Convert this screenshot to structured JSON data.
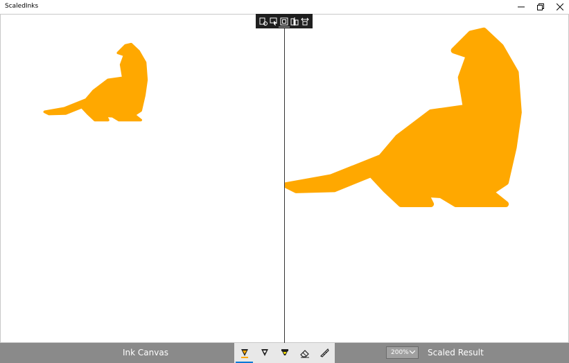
{
  "window": {
    "title": "ScaledInks"
  },
  "canvas": {
    "ink_color": "#FFA800"
  },
  "labels": {
    "left": "Ink Canvas",
    "right": "Scaled Result"
  },
  "zoom": {
    "selected": "200%"
  },
  "ink_toolbar": {
    "tools": [
      {
        "name": "ballpoint-pen",
        "selected": true
      },
      {
        "name": "pencil",
        "selected": false
      },
      {
        "name": "highlighter",
        "selected": false
      },
      {
        "name": "eraser",
        "selected": false
      },
      {
        "name": "ruler",
        "selected": false
      }
    ]
  },
  "floating_toolbar": [
    "document-settings-icon",
    "select-icon",
    "frame-icon",
    "mirror-icon",
    "scale-icon"
  ],
  "colors": {
    "bottom_bar": "#8a8a8a",
    "accent": "#0078d7"
  }
}
